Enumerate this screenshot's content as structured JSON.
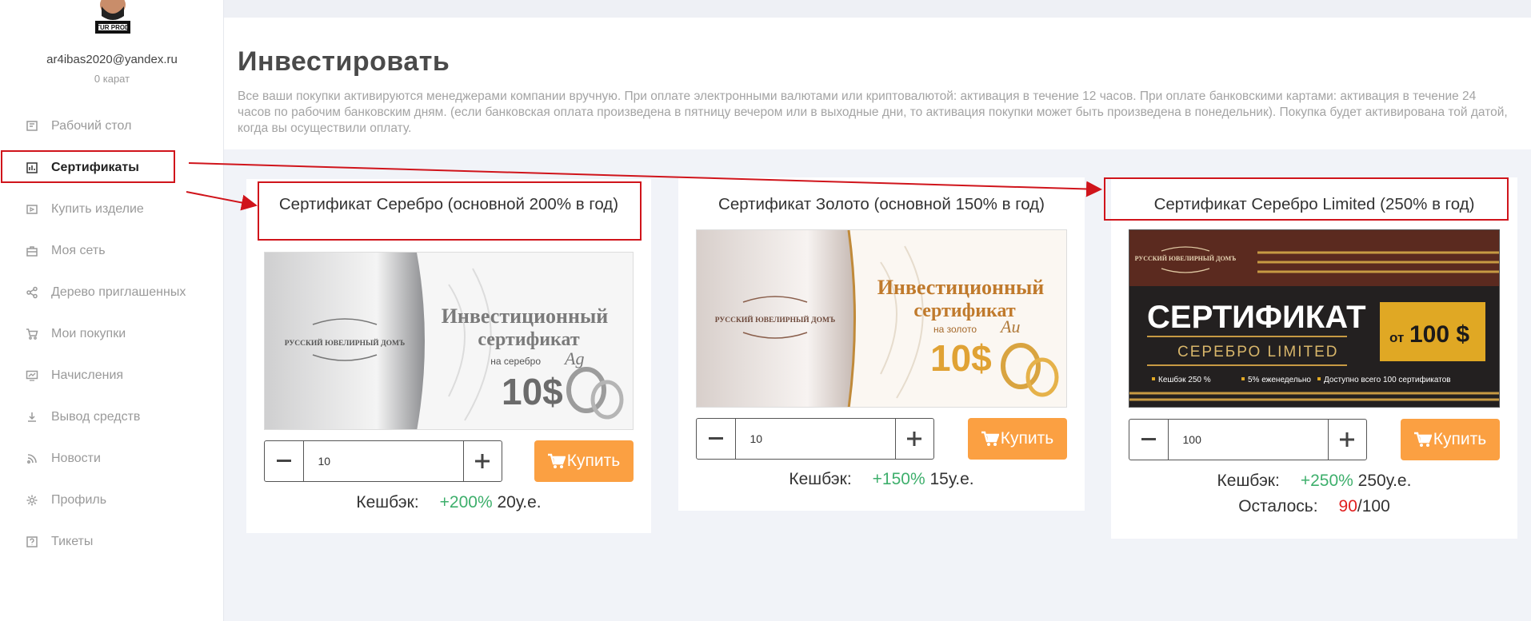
{
  "user": {
    "email": "ar4ibas2020@yandex.ru",
    "karat": "0 карат"
  },
  "sidebar": {
    "items": [
      {
        "label": "Рабочий стол",
        "icon": "dashboard-icon"
      },
      {
        "label": "Сертификаты",
        "icon": "chart-icon",
        "active": true
      },
      {
        "label": "Купить изделие",
        "icon": "video-icon"
      },
      {
        "label": "Моя сеть",
        "icon": "briefcase-icon"
      },
      {
        "label": "Дерево приглашенных",
        "icon": "share-icon"
      },
      {
        "label": "Мои покупки",
        "icon": "cart-icon"
      },
      {
        "label": "Начисления",
        "icon": "monitor-icon"
      },
      {
        "label": "Вывод средств",
        "icon": "download-icon"
      },
      {
        "label": "Новости",
        "icon": "rss-icon"
      },
      {
        "label": "Профиль",
        "icon": "gear-icon"
      },
      {
        "label": "Тикеты",
        "icon": "help-icon"
      }
    ]
  },
  "page": {
    "title": "Инвестировать",
    "description": "Все ваши покупки активируются менеджерами компании вручную. При оплате электронными валютами или криптовалютой: активация в течение 12 часов. При оплате банковскими картами: активация в течение 24 часов по рабочим банковским дням. (если банковская оплата произведена в пятницу вечером или в выходные дни, то активация покупки может быть произведена в понедельник). Покупка будет активирована той датой, когда вы осуществили оплату."
  },
  "cards": [
    {
      "title": "Сертификат Серебро (основной 200% в год)",
      "image": {
        "brand": "РУССКИЙ ЮВЕЛИРНЫЙ ДОМЪ",
        "line1": "Инвестиционный",
        "line2": "сертификат",
        "sub": "на серебро",
        "symbol": "Ag",
        "price": "10$"
      },
      "qty": "10",
      "buy_label": "Купить",
      "cashback_label": "Кешбэк:",
      "cashback_pct": "+200%",
      "cashback_amount": "20у.е."
    },
    {
      "title": "Сертификат Золото (основной 150% в год)",
      "image": {
        "brand": "РУССКИЙ ЮВЕЛИРНЫЙ ДОМЪ",
        "line1": "Инвестиционный",
        "line2": "сертификат",
        "sub": "на золото",
        "symbol": "Au",
        "price": "10$"
      },
      "qty": "10",
      "buy_label": "Купить",
      "cashback_label": "Кешбэк:",
      "cashback_pct": "+150%",
      "cashback_amount": "15у.е."
    },
    {
      "title": "Сертификат Серебро Limited (250% в год)",
      "image": {
        "brand": "РУССКИЙ ЮВЕЛИРНЫЙ ДОМЪ",
        "headline": "СЕРТИФИКАТ",
        "subline": "СЕРЕБРО LIMITED",
        "price_prefix": "от",
        "price": "100 $",
        "bullet1": "Кешбэк 250 %",
        "bullet2": "5% еженедельно",
        "bullet3": "Доступно всего 100 сертификатов"
      },
      "qty": "100",
      "buy_label": "Купить",
      "cashback_label": "Кешбэк:",
      "cashback_pct": "+250%",
      "cashback_amount": "250у.е.",
      "remain_label": "Осталось:",
      "remain_left": "90",
      "remain_total": "/100"
    }
  ],
  "colors": {
    "accent": "#fba042",
    "cashback": "#3eaf6c",
    "remain": "#e02020",
    "annotation": "#d0141b"
  }
}
